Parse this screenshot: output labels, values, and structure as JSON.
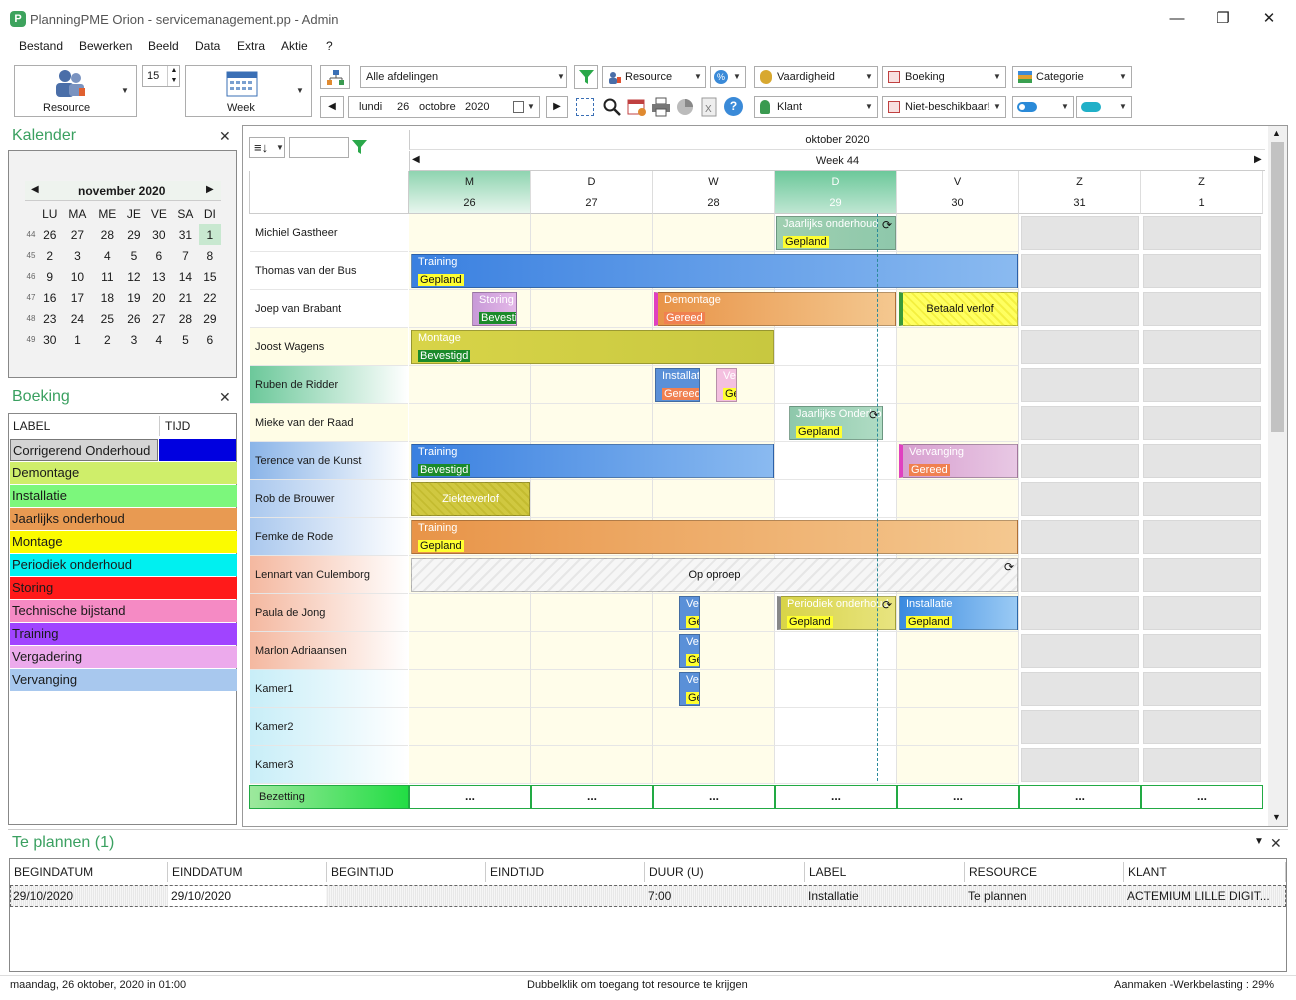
{
  "window": {
    "logo": "P",
    "title": "PlanningPME Orion - servicemanagement.pp - Admin",
    "min": "—",
    "max": "❐",
    "close": "✕"
  },
  "menu": [
    "Bestand",
    "Bewerken",
    "Beeld",
    "Data",
    "Extra",
    "Aktie",
    "?"
  ],
  "toolbar": {
    "resource_label": "Resource",
    "interval": "15",
    "view_label": "Week",
    "departments": "Alle afdelingen",
    "resource_filter": "Resource",
    "skill_filter": "Vaardigheid",
    "booking_filter": "Boeking",
    "category_filter": "Categorie",
    "date_day": "lundi",
    "date_num": "26",
    "date_month": "octobre",
    "date_year": "2020",
    "client_filter": "Klant",
    "unavailability_filter": "Niet-beschikbaar!"
  },
  "calendar": {
    "title": "Kalender",
    "month": "november 2020",
    "weekdays": [
      "LU",
      "MA",
      "ME",
      "JE",
      "VE",
      "SA",
      "DI"
    ],
    "weeks": [
      {
        "wk": "44",
        "days": [
          "26",
          "27",
          "28",
          "29",
          "30",
          "31",
          "1"
        ]
      },
      {
        "wk": "45",
        "days": [
          "2",
          "3",
          "4",
          "5",
          "6",
          "7",
          "8"
        ]
      },
      {
        "wk": "46",
        "days": [
          "9",
          "10",
          "11",
          "12",
          "13",
          "14",
          "15"
        ]
      },
      {
        "wk": "47",
        "days": [
          "16",
          "17",
          "18",
          "19",
          "20",
          "21",
          "22"
        ]
      },
      {
        "wk": "48",
        "days": [
          "23",
          "24",
          "25",
          "26",
          "27",
          "28",
          "29"
        ]
      },
      {
        "wk": "49",
        "days": [
          "30",
          "1",
          "2",
          "3",
          "4",
          "5",
          "6"
        ]
      }
    ]
  },
  "booking": {
    "title": "Boeking",
    "col_label": "LABEL",
    "col_time": "TIJD",
    "items": [
      {
        "label": "Corrigerend Onderhoud",
        "color": "#d4d4d4"
      },
      {
        "label": "Demontage",
        "color": "#cfee6a"
      },
      {
        "label": "Installatie",
        "color": "#7cf77c"
      },
      {
        "label": "Jaarlijks onderhoud",
        "color": "#e89a52"
      },
      {
        "label": "Montage",
        "color": "#fbfb00"
      },
      {
        "label": "Periodiek onderhoud",
        "color": "#00f0f0"
      },
      {
        "label": "Storing",
        "color": "#ff1a1a"
      },
      {
        "label": "Technische bijstand",
        "color": "#f58ac4"
      },
      {
        "label": "Training",
        "color": "#a044ff"
      },
      {
        "label": "Vergadering",
        "color": "#ecaaec"
      },
      {
        "label": "Vervanging",
        "color": "#a8c8ee"
      }
    ]
  },
  "planning": {
    "month": "oktober 2020",
    "week": "Week 44",
    "days": [
      {
        "d": "M",
        "n": "26"
      },
      {
        "d": "D",
        "n": "27"
      },
      {
        "d": "W",
        "n": "28"
      },
      {
        "d": "D",
        "n": "29"
      },
      {
        "d": "V",
        "n": "30"
      },
      {
        "d": "Z",
        "n": "31"
      },
      {
        "d": "Z",
        "n": "1"
      }
    ],
    "resources": [
      "Michiel Gastheer",
      "Thomas van der Bus",
      "Joep van Brabant",
      "Joost Wagens",
      "Ruben de Ridder",
      "Mieke van der Raad",
      "Terence van de Kunst",
      "Rob de Brouwer",
      "Femke de Rode",
      "Lennart van Culemborg",
      "Paula de Jong",
      "Marlon Adriaansen",
      "Kamer1",
      "Kamer2",
      "Kamer3"
    ],
    "occupancy_label": "Bezetting",
    "occupancy_value": "...",
    "tasks": [
      {
        "title": "Jaarlijks onderhoud",
        "status": "Gepland"
      },
      {
        "title": "Training",
        "status": "Gepland"
      },
      {
        "title": "Storing",
        "status": "Bevestigd"
      },
      {
        "title": "Demontage",
        "status": "Gereed"
      },
      {
        "title": "Betaald verlof"
      },
      {
        "title": "Montage",
        "status": "Bevestigd"
      },
      {
        "title": "Installatie",
        "status": "Gereed"
      },
      {
        "title": "Ve",
        "status": "Ge"
      },
      {
        "title": "Jaarlijks Onderhoud",
        "status": "Gepland"
      },
      {
        "title": "Training",
        "status": "Bevestigd"
      },
      {
        "title": "Vervanging",
        "status": "Gereed"
      },
      {
        "title": "Ziekteverlof"
      },
      {
        "title": "Training",
        "status": "Gepland"
      },
      {
        "title": "Op oproep"
      },
      {
        "title": "Ve",
        "status": "Ge"
      },
      {
        "title": "Periodiek onderhoud",
        "status": "Gepland"
      },
      {
        "title": "Installatie",
        "status": "Gepland"
      },
      {
        "title": "Ve",
        "status": "Ge"
      },
      {
        "title": "Ve",
        "status": "Ge"
      }
    ]
  },
  "toplan": {
    "title": "Te plannen (1)",
    "columns": [
      "BEGINDATUM",
      "EINDDATUM",
      "BEGINTIJD",
      "EINDTIJD",
      "DUUR (U)",
      "LABEL",
      "RESOURCE",
      "KLANT"
    ],
    "row": [
      "29/10/2020",
      "29/10/2020",
      "",
      "",
      "7:00",
      "Installatie",
      "Te plannen",
      "ACTEMIUM LILLE DIGIT..."
    ]
  },
  "status": {
    "left": "maandag, 26 oktober, 2020 in 01:00",
    "center": "Dubbelklik om toegang tot resource te krijgen",
    "right": "Aanmaken -Werkbelasting : 29%"
  }
}
